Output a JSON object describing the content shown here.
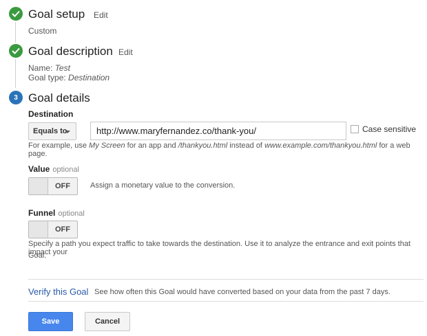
{
  "steps": [
    {
      "number": "",
      "title": "Goal setup",
      "edit_label": "Edit",
      "details": [
        "Custom"
      ]
    },
    {
      "number": "",
      "title": "Goal description",
      "edit_label": "Edit",
      "name_label": "Name:",
      "name_value": "Test",
      "type_label": "Goal type:",
      "type_value": "Destination"
    },
    {
      "number": "3",
      "title": "Goal details"
    }
  ],
  "destination": {
    "label": "Destination",
    "match_type": "Equals to",
    "url_value": "http://www.maryfernandez.co/thank-you/",
    "case_sensitive_label": "Case sensitive",
    "help": {
      "prefix": "For example, use ",
      "example_app": "My Screen",
      "middle1": " for an app and ",
      "example_page": "/thankyou.html",
      "middle2": " instead of ",
      "example_url": "www.example.com/thankyou.html",
      "suffix": " for a web page."
    }
  },
  "value": {
    "label": "Value",
    "optional": "optional",
    "toggle_text": "OFF",
    "description": "Assign a monetary value to the conversion."
  },
  "funnel": {
    "label": "Funnel",
    "optional": "optional",
    "toggle_text": "OFF",
    "description_line1": "Specify a path you expect traffic to take towards the destination. Use it to analyze the entrance and exit points that impact your",
    "description_line2": "Goal."
  },
  "verify": {
    "link_label": "Verify this Goal",
    "description": "See how often this Goal would have converted based on your data from the past 7 days."
  },
  "actions": {
    "save_label": "Save",
    "cancel_label": "Cancel"
  },
  "colors": {
    "check_green": "#3a9a3f",
    "step_blue": "#2a73b8",
    "link_blue": "#2a5aa8",
    "save_blue": "#4787ed"
  }
}
